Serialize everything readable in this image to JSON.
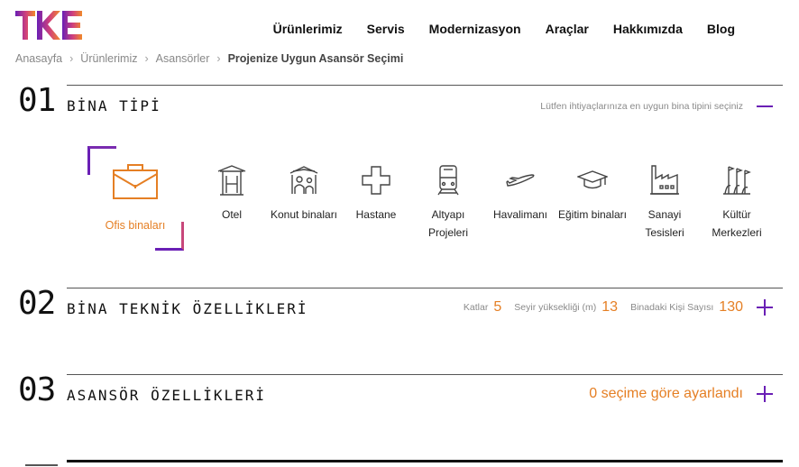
{
  "brand": {
    "logo_text": "TKE",
    "accent": "#6a1fb5",
    "orange": "#e57f24"
  },
  "nav": {
    "items": [
      "Ürünlerimiz",
      "Servis",
      "Modernizasyon",
      "Araçlar",
      "Hakkımızda",
      "Blog"
    ]
  },
  "breadcrumb": {
    "items": [
      "Anasayfa",
      "Ürünlerimiz",
      "Asansörler"
    ],
    "current": "Projenize Uygun Asansör Seçimi"
  },
  "step1": {
    "number": "01",
    "title": "BİNA TİPİ",
    "hint": "Lütfen ihtiyaçlarınıza en uygun bina tipini seçiniz",
    "toggle": "minus-icon",
    "types": [
      {
        "label": "Ofis binaları",
        "icon": "briefcase-icon",
        "selected": true
      },
      {
        "label": "Otel",
        "icon": "hotel-icon"
      },
      {
        "label": "Konut binaları",
        "icon": "residential-icon"
      },
      {
        "label": "Hastane",
        "icon": "hospital-cross-icon"
      },
      {
        "label": "Altyapı Projeleri",
        "icon": "train-icon"
      },
      {
        "label": "Havalimanı",
        "icon": "airplane-icon"
      },
      {
        "label": "Eğitim binaları",
        "icon": "graduation-cap-icon"
      },
      {
        "label": "Sanayi Tesisleri",
        "icon": "factory-icon"
      },
      {
        "label": "Kültür Merkezleri",
        "icon": "culture-flags-icon"
      }
    ]
  },
  "step2": {
    "number": "02",
    "title": "BİNA TEKNİK ÖZELLİKLERİ",
    "floors_label": "Katlar",
    "floors_value": "5",
    "travel_label": "Seyir yüksekliği (m)",
    "travel_value": "13",
    "people_label": "Binadaki Kişi Sayısı",
    "people_value": "130",
    "toggle": "plus-icon"
  },
  "step3": {
    "number": "03",
    "title": "ASANSÖR ÖZELLİKLERİ",
    "status": "0 seçime göre ayarlandı",
    "toggle": "plus-icon"
  }
}
